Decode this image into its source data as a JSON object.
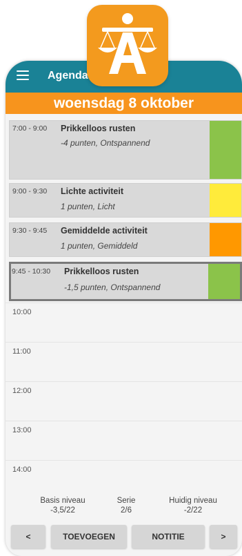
{
  "app": {
    "title": "Agenda",
    "date": "woensdag 8 oktober"
  },
  "colors": {
    "appbar": "#1a8296",
    "date_bar": "#f7941d",
    "ontspannend": "#8bc34a",
    "licht": "#ffeb3b",
    "gemiddeld": "#ff9800"
  },
  "events": [
    {
      "time": "7:00 - 9:00",
      "name": "Prikkelloos rusten",
      "detail": "-4 punten, Ontspannend",
      "color": "#8bc34a"
    },
    {
      "time": "9:00 - 9:30",
      "name": "Lichte activiteit",
      "detail": "1 punten, Licht",
      "color": "#ffeb3b"
    },
    {
      "time": "9:30 - 9:45",
      "name": "Gemiddelde activiteit",
      "detail": "1 punten, Gemiddeld",
      "color": "#ff9800"
    },
    {
      "time": "9:45 - 10:30",
      "name": "Prikkelloos rusten",
      "detail": "-1,5 punten, Ontspannend",
      "color": "#8bc34a"
    }
  ],
  "hours": [
    "10:00",
    "11:00",
    "12:00",
    "13:00",
    "14:00"
  ],
  "status": {
    "basis_label": "Basis niveau",
    "basis_value": "-3,5/22",
    "serie_label": "Serie",
    "serie_value": "2/6",
    "huidig_label": "Huidig niveau",
    "huidig_value": "-2/22"
  },
  "buttons": {
    "prev": "<",
    "add": "TOEVOEGEN",
    "note": "NOTITIE",
    "next": ">"
  },
  "icons": {
    "menu": "hamburger-menu-icon",
    "logo": "scales-letter-a-logo"
  }
}
